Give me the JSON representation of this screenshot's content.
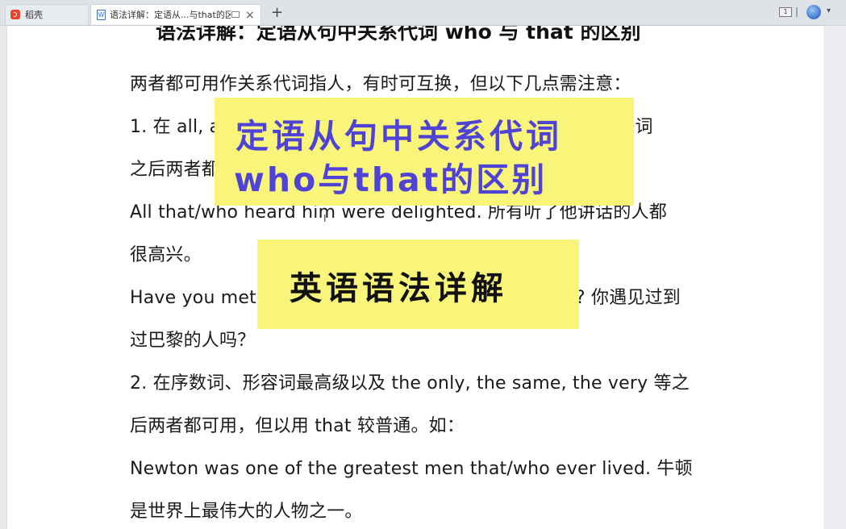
{
  "tabs": {
    "home_label": "稻壳",
    "doc_icon_letter": "W",
    "doc_label": "语法详解：定语从...与that的区别"
  },
  "window": {
    "newtab_symbol": "+",
    "counter": "1"
  },
  "document": {
    "title": "语法详解：定语从句中关系代词 who 与 that 的区别",
    "lines": [
      "两者都可用作关系代词指人，有时可互换，但以下几点需注意：",
      "1. 在 all, any, anyone, everybody, nobody, somebody 等词",
      "之后两者都可用，但以用 that 较普通。如：",
      "All that/who heard him were delighted. 所有听了他讲话的人都",
      "很高兴。",
      "Have you met anyone that/who has been to Paris? 你遇见过到",
      "过巴黎的人吗？",
      "2. 在序数词、形容词最高级以及 the only, the same, the very 等之",
      "后两者都可用，但以用 that 较普通。如：",
      "Newton was one of the greatest men that/who ever lived. 牛顿",
      "是世界上最伟大的人物之一。"
    ]
  },
  "overlay": {
    "main_line1": "定语从句中关系代词",
    "main_line2": "who与that的区别",
    "sub": "英语语法详解",
    "main_color": "#4f43d6",
    "banner_color": "#f8f57a"
  }
}
